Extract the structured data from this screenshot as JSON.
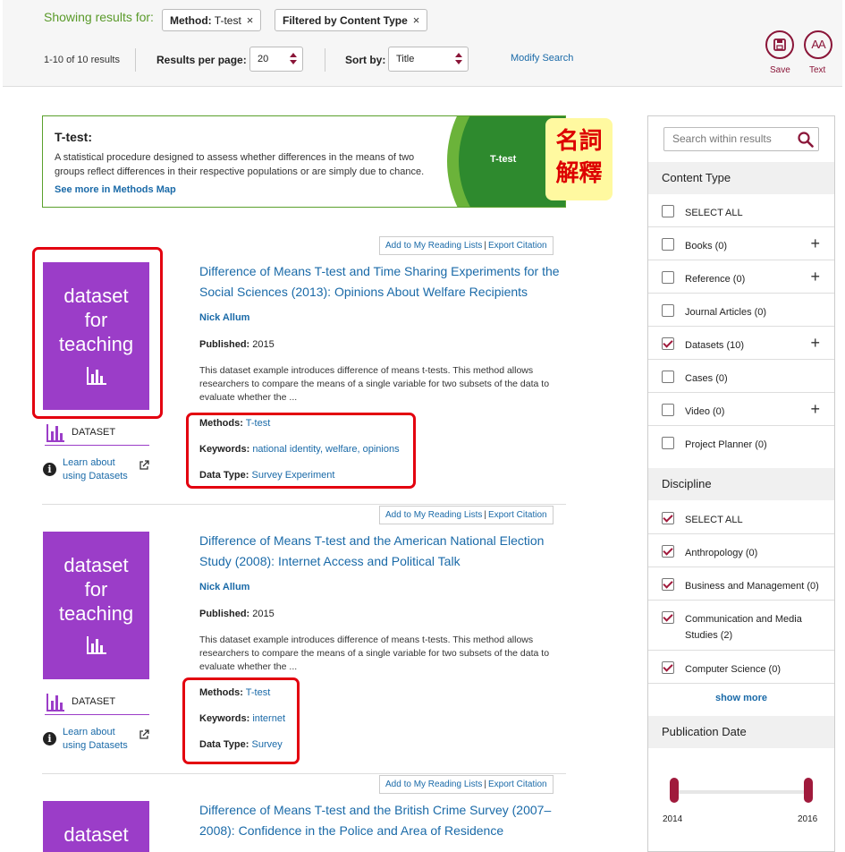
{
  "header": {
    "showing_label": "Showing results for:",
    "chips": [
      {
        "key": "Method:",
        "value": " T-test"
      },
      {
        "key": "Filtered by Content Type",
        "value": ""
      }
    ],
    "chip_close": "×",
    "result_count": "1-10 of 10 results",
    "per_page_label": "Results per page:",
    "per_page_value": "20",
    "sort_label": "Sort by:",
    "sort_value": "Title",
    "modify_search": "Modify Search",
    "save_label": "Save",
    "text_label": "Text",
    "text_icon_glyph": "AA"
  },
  "method_box": {
    "title": "T-test:",
    "description": "A statistical procedure designed to assess whether differences in the means of two groups reflect differences in their respective populations or are simply due to chance.",
    "link": "See more in Methods Map",
    "graphic_label": "T-test",
    "annotation": "名詞\n解釋"
  },
  "results": [
    {
      "thumb": "dataset\nfor\nteaching",
      "type": "DATASET",
      "learn": "Learn about\nusing Datasets",
      "add_list": "Add to My Reading Lists",
      "export": "Export Citation",
      "title": "Difference of Means T-test and Time Sharing Experiments for the Social Sciences (2013): Opinions About Welfare Recipients",
      "author": "Nick Allum",
      "published_label": "Published:",
      "published": " 2015",
      "description": "This dataset example introduces difference of means t-tests. This method allows researchers to compare the means of a single variable for two subsets of the data to evaluate whether the ...",
      "methods_label": "Methods:",
      "methods": "T-test",
      "keywords_label": "Keywords:",
      "keywords": "national identity, welfare, opinions",
      "datatype_label": "Data Type:",
      "datatype": "Survey Experiment"
    },
    {
      "thumb": "dataset\nfor\nteaching",
      "type": "DATASET",
      "learn": "Learn about\nusing Datasets",
      "add_list": "Add to My Reading Lists",
      "export": "Export Citation",
      "title": "Difference of Means T-test and the American National Election Study (2008): Internet Access and Political Talk",
      "author": "Nick Allum",
      "published_label": "Published:",
      "published": " 2015",
      "description": "This dataset example introduces difference of means t-tests. This method allows researchers to compare the means of a single variable for two subsets of the data to evaluate whether the ...",
      "methods_label": "Methods:",
      "methods": "T-test",
      "keywords_label": "Keywords:",
      "keywords": "internet",
      "datatype_label": "Data Type:",
      "datatype": "Survey"
    },
    {
      "thumb": "dataset",
      "add_list": "Add to My Reading Lists",
      "export": "Export Citation",
      "title": "Difference of Means T-test and the British Crime Survey (2007–2008): Confidence in the Police and Area of Residence"
    }
  ],
  "sidebar": {
    "search_placeholder": "Search within results",
    "content_type_heading": "Content Type",
    "content_type": [
      {
        "label": "SELECT ALL",
        "checked": false,
        "expand": false
      },
      {
        "label": "Books (0)",
        "checked": false,
        "expand": true
      },
      {
        "label": "Reference (0)",
        "checked": false,
        "expand": true
      },
      {
        "label": "Journal Articles (0)",
        "checked": false,
        "expand": false
      },
      {
        "label": "Datasets (10)",
        "checked": true,
        "expand": true
      },
      {
        "label": "Cases (0)",
        "checked": false,
        "expand": false
      },
      {
        "label": "Video (0)",
        "checked": false,
        "expand": true
      },
      {
        "label": "Project Planner (0)",
        "checked": false,
        "expand": false
      }
    ],
    "discipline_heading": "Discipline",
    "discipline": [
      {
        "label": "SELECT ALL",
        "checked": true
      },
      {
        "label": "Anthropology (0)",
        "checked": true
      },
      {
        "label": "Business and Management (0)",
        "checked": true
      },
      {
        "label": "Communication and Media Studies (2)",
        "checked": true
      },
      {
        "label": "Computer Science (0)",
        "checked": true
      }
    ],
    "show_more": "show more",
    "pubdate_heading": "Publication Date",
    "year_min": "2014",
    "year_max": "2016",
    "plus_glyph": "+"
  },
  "colors": {
    "accent": "#8a1538",
    "link": "#1a6aa8",
    "dataset": "#9b3dc8",
    "green": "#5aa02c",
    "annotation": "#e3000f"
  }
}
